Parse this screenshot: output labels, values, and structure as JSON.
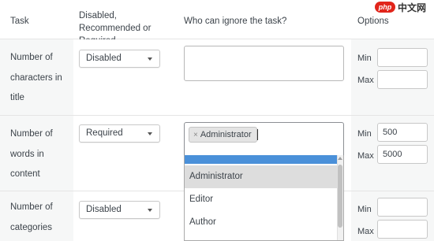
{
  "header": {
    "task": "Task",
    "requirement": "Disabled, Recommended or Required",
    "who": "Who can ignore the task?",
    "options": "Options"
  },
  "rows": [
    {
      "task": "Number of characters in title",
      "status": "Disabled",
      "ignore_tags": [],
      "min_label": "Min",
      "min_value": "",
      "max_label": "Max",
      "max_value": ""
    },
    {
      "task": "Number of words in content",
      "status": "Required",
      "ignore_tags": [
        "Administrator"
      ],
      "tag_remove": "×",
      "min_label": "Min",
      "min_value": "500",
      "max_label": "Max",
      "max_value": "5000"
    },
    {
      "task": "Number of categories",
      "status": "Disabled",
      "min_label": "Min",
      "min_value": "",
      "max_label": "Max",
      "max_value": ""
    }
  ],
  "dropdown": {
    "options": [
      "Administrator",
      "Editor",
      "Author"
    ],
    "highlighted": "Administrator"
  },
  "watermark": {
    "badge": "php",
    "text": "中文网"
  },
  "colors": {
    "focus_blue": "#4a90d9",
    "highlight": "#dddddd",
    "cell_bg": "#f6f7f7"
  }
}
